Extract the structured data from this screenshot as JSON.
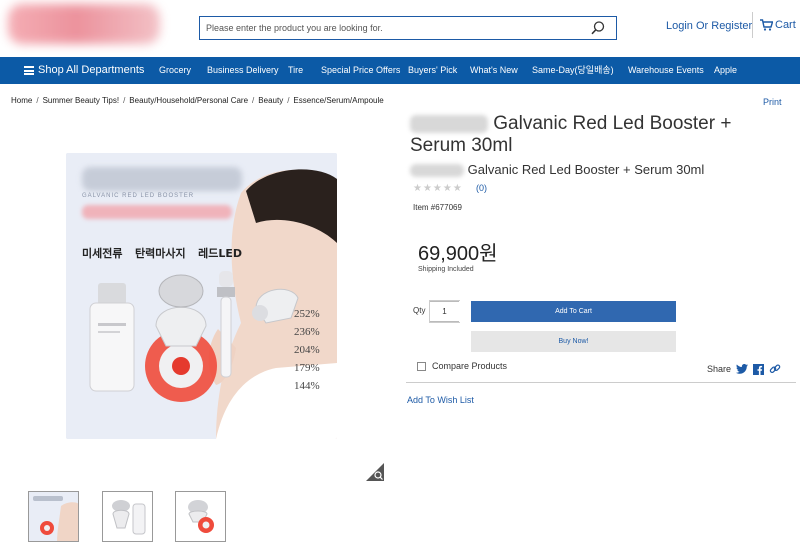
{
  "header": {
    "search_placeholder": "Please enter the product you are looking for.",
    "login_label": "Login Or Register",
    "cart_label": "Cart"
  },
  "nav": {
    "shop_all": "Shop All Departments",
    "items": [
      "Grocery",
      "Business Delivery",
      "Tire",
      "Special Price Offers",
      "Buyers' Pick",
      "What's New",
      "Same-Day(당일배송)",
      "Warehouse Events",
      "Apple"
    ]
  },
  "breadcrumb": [
    "Home",
    "Summer Beauty Tips!",
    "Beauty/Household/Personal Care",
    "Beauty",
    "Essence/Serum/Ampoule"
  ],
  "print_label": "Print",
  "product": {
    "title": "Galvanic Red Led Booster + Serum 30ml",
    "subtitle": "Galvanic Red Led Booster + Serum 30ml",
    "review_count": "(0)",
    "item_number": "Item #677069",
    "price": "69,900원",
    "shipping": "Shipping Included",
    "qty_label": "Qty",
    "qty_value": "1",
    "add_to_cart": "Add To Cart",
    "buy_now": "Buy Now!",
    "compare_label": "Compare Products",
    "share_label": "Share",
    "wishlist_label": "Add To Wish List"
  },
  "product_image": {
    "banner": "GALVANIC RED LED BOOSTER",
    "features": [
      "미세전류",
      "탄력마사지",
      "레드LED"
    ],
    "stats": [
      "252%",
      "236%",
      "204%",
      "179%",
      "144%"
    ]
  },
  "colors": {
    "nav_bg": "#0c5aa6",
    "link": "#1d5aa6",
    "cart_button": "#3068b0"
  }
}
